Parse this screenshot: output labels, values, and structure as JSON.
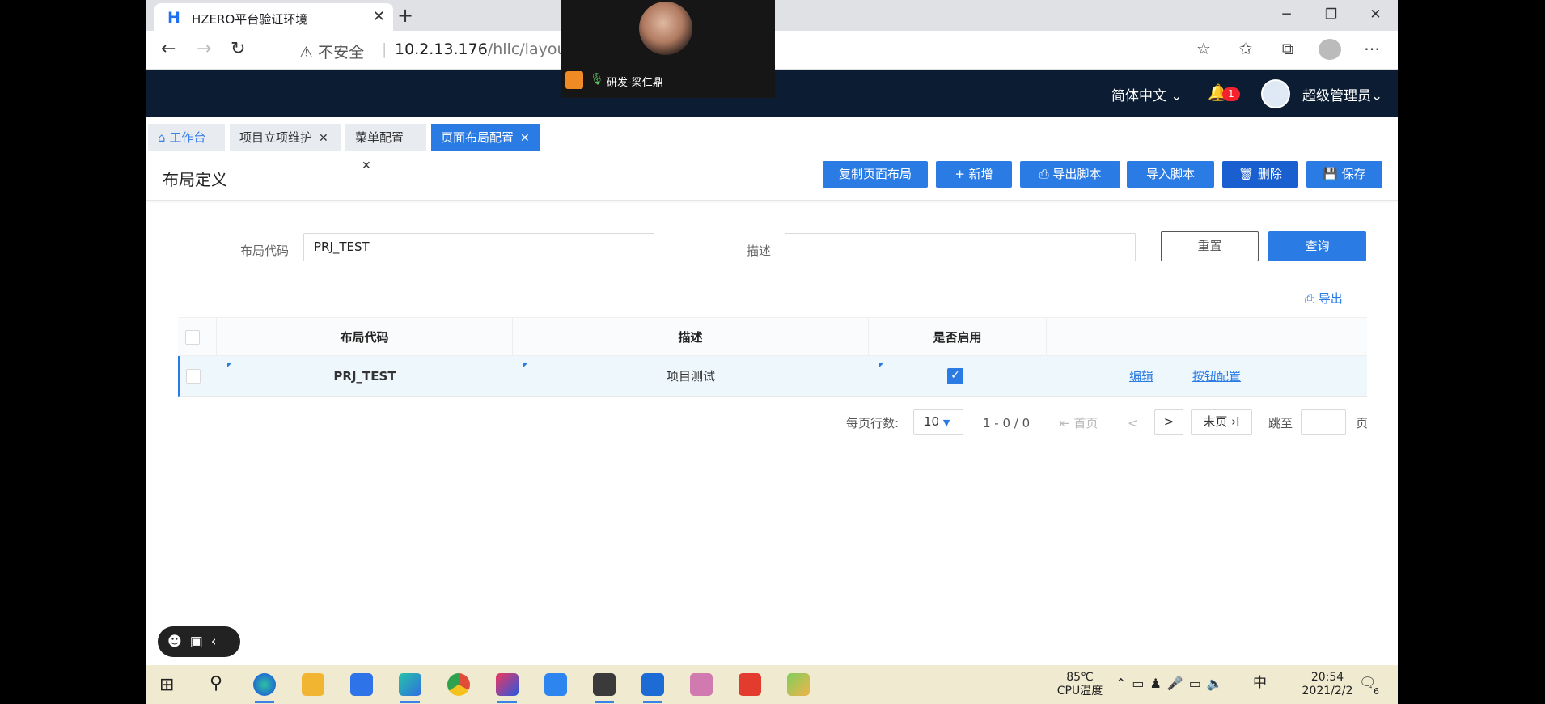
{
  "browser": {
    "tab_title": "HZERO平台验证环境",
    "insecure_label": "不安全",
    "url_host": "10.2.13.176",
    "url_path": "/hllc/layout/c"
  },
  "header": {
    "language": "简体中文",
    "notification_count": "1",
    "username": "超级管理员"
  },
  "page_tabs": [
    {
      "label": "工作台"
    },
    {
      "label": "项目立项维护"
    },
    {
      "label": "菜单配置"
    },
    {
      "label": "页面布局配置"
    }
  ],
  "page": {
    "title": "布局定义",
    "actions": {
      "copy": "复制页面布局",
      "add": "新增",
      "export_script": "导出脚本",
      "import_script": "导入脚本",
      "delete": "删除",
      "save": "保存"
    }
  },
  "search": {
    "code_label": "布局代码",
    "code_value": "PRJ_TEST",
    "desc_label": "描述",
    "desc_value": "",
    "reset": "重置",
    "query": "查询",
    "export": "导出"
  },
  "table": {
    "headers": [
      "布局代码",
      "描述",
      "是否启用"
    ],
    "rows": [
      {
        "code": "PRJ_TEST",
        "desc": "项目测试",
        "enabled": true,
        "edit": "编辑",
        "button_config": "按钮配置"
      }
    ]
  },
  "pagination": {
    "rows_per_page_label": "每页行数:",
    "page_size": "10",
    "range": "1 - 0 / 0",
    "first": "首页",
    "prev": "<",
    "next": ">",
    "last": "末页",
    "jump_label": "跳至",
    "page_label": "页"
  },
  "video_overlay": {
    "speaker": "研发-梁仁鼎"
  },
  "taskbar": {
    "temperature": "85℃",
    "cpu_label": "CPU温度",
    "ime": "中",
    "time": "20:54",
    "date": "2021/2/2",
    "notification_count": "6"
  },
  "colors": {
    "primary": "#2b7be4",
    "header_bg": "#0c1c33"
  }
}
